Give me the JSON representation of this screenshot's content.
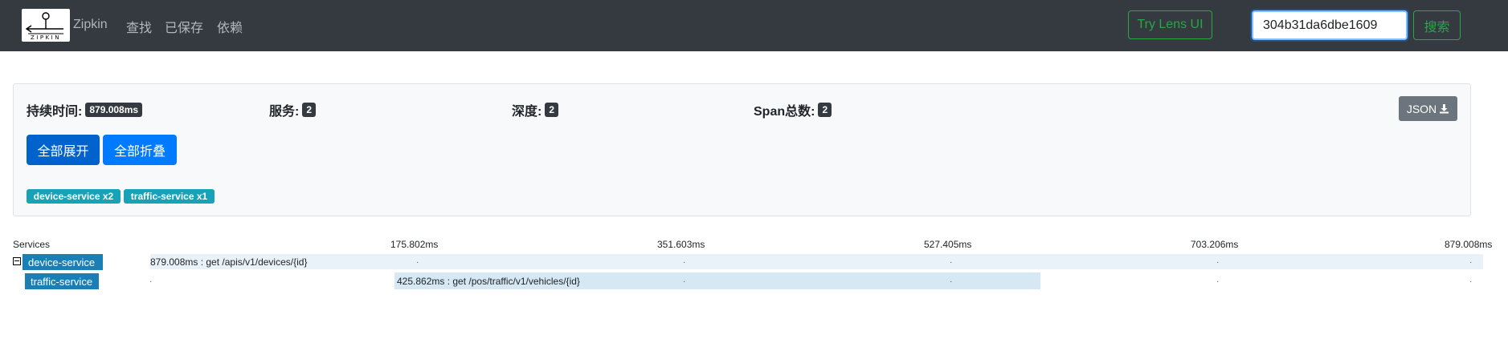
{
  "navbar": {
    "logo_text": "ZIPKIN",
    "brand": "Zipkin",
    "links": [
      "查找",
      "已保存",
      "依赖"
    ],
    "lens_button": "Try Lens UI",
    "search_value": "304b31da6dbe1609",
    "search_button": "搜索"
  },
  "summary": {
    "duration_label": "持续时间:",
    "duration_value": "879.008ms",
    "services_label": "服务:",
    "services_value": "2",
    "depth_label": "深度:",
    "depth_value": "2",
    "span_total_label": "Span总数:",
    "span_total_value": "2",
    "json_button": "JSON",
    "expand_all": "全部展开",
    "collapse_all": "全部折叠",
    "service_badges": [
      "device-service x2",
      "traffic-service x1"
    ]
  },
  "timeline": {
    "services_header": "Services",
    "ticks": [
      "175.802ms",
      "351.603ms",
      "527.405ms",
      "703.206ms",
      "879.008ms"
    ],
    "rows": [
      {
        "service": "device-service",
        "span_label": "879.008ms : get /apis/v1/devices/{id}",
        "expanded": true
      },
      {
        "service": "traffic-service",
        "span_label": "425.862ms : get /pos/traffic/v1/vehicles/{id}"
      }
    ]
  },
  "colors": {
    "navbar": "#343a40",
    "primary": "#007bff",
    "success": "#28a745",
    "info": "#17a2b8",
    "service_tag": "#1b7fb5",
    "span_bar": "#d5e8f3"
  }
}
